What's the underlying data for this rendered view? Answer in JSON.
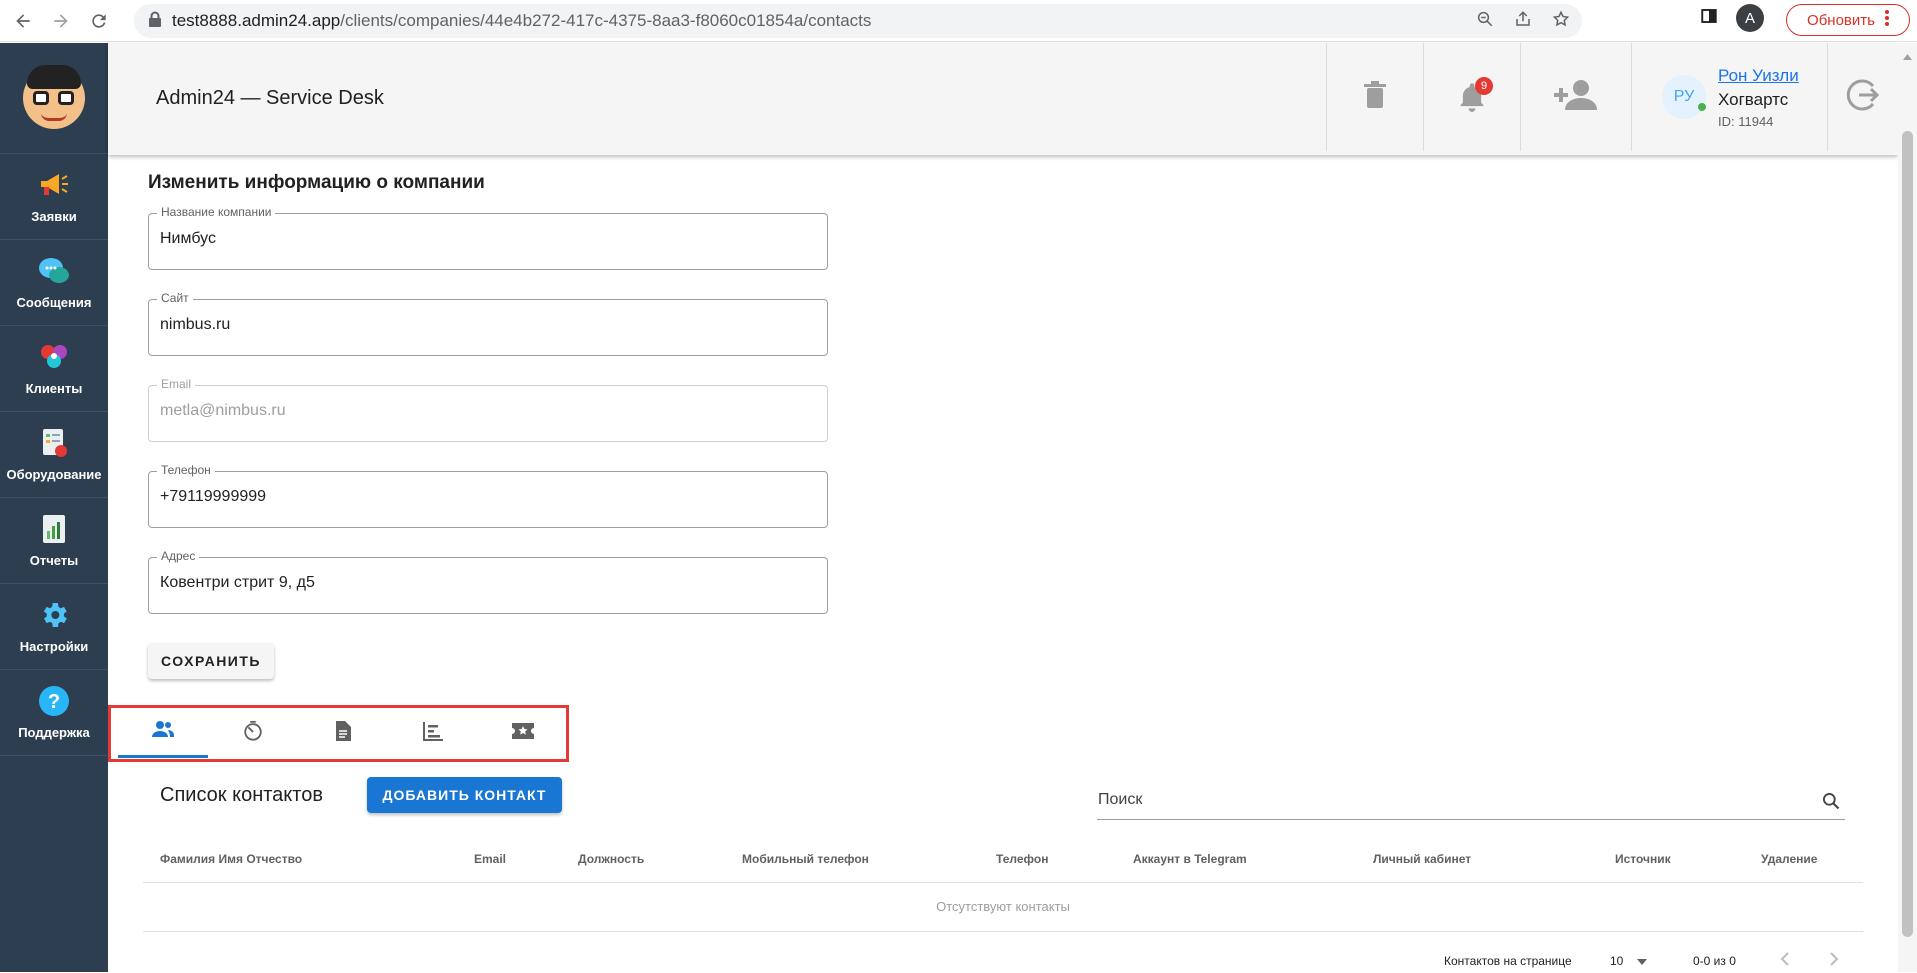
{
  "browser": {
    "url_host": "test8888.admin24.app",
    "url_path": "/clients/companies/44e4b272-417c-4375-8aa3-f8060c01854a/contacts",
    "profile_initial": "A",
    "update_label": "Обновить"
  },
  "sidebar": {
    "items": [
      {
        "label": "Заявки",
        "icon": "megaphone-icon"
      },
      {
        "label": "Сообщения",
        "icon": "chat-bubbles-icon"
      },
      {
        "label": "Клиенты",
        "icon": "clients-icon"
      },
      {
        "label": "Оборудование",
        "icon": "equipment-icon"
      },
      {
        "label": "Отчеты",
        "icon": "report-icon"
      },
      {
        "label": "Настройки",
        "icon": "gear-icon"
      },
      {
        "label": "Поддержка",
        "icon": "help-icon"
      }
    ]
  },
  "header": {
    "title": "Admin24 — Service Desk",
    "notifications_count": "9",
    "user": {
      "initials": "РУ",
      "name": "Рон Уизли",
      "org": "Хогвартс",
      "id": "ID: 11944"
    }
  },
  "form": {
    "title": "Изменить информацию о компании",
    "fields": [
      {
        "label": "Название компании",
        "value": "Нимбус"
      },
      {
        "label": "Сайт",
        "value": "nimbus.ru"
      },
      {
        "label": "Email",
        "value": "metla@nimbus.ru"
      },
      {
        "label": "Телефон",
        "value": "+79119999999"
      },
      {
        "label": "Адрес",
        "value": "Ковентри стрит 9, д5"
      }
    ],
    "save_label": "СОХРАНИТЬ"
  },
  "tabs": [
    {
      "icon": "contacts-icon",
      "active": true
    },
    {
      "icon": "timer-icon",
      "active": false
    },
    {
      "icon": "document-icon",
      "active": false
    },
    {
      "icon": "timeline-icon",
      "active": false
    },
    {
      "icon": "ticket-icon",
      "active": false
    }
  ],
  "contacts": {
    "title": "Список контактов",
    "add_label": "ДОБАВИТЬ КОНТАКТ",
    "search_placeholder": "Поиск",
    "columns": [
      "Фамилия Имя Отчество",
      "Email",
      "Должность",
      "Мобильный телефон",
      "Телефон",
      "Аккаунт в Telegram",
      "Личный кабинет",
      "Источник",
      "Удаление"
    ],
    "empty_text": "Отсутствуют контакты",
    "rows_per_page_label": "Контактов на странице",
    "rows_per_page": "10",
    "range": "0-0 из 0"
  },
  "colors": {
    "sidebar_bg": "#2d3e50",
    "primary": "#1976d2",
    "highlight_border": "#e53935"
  }
}
